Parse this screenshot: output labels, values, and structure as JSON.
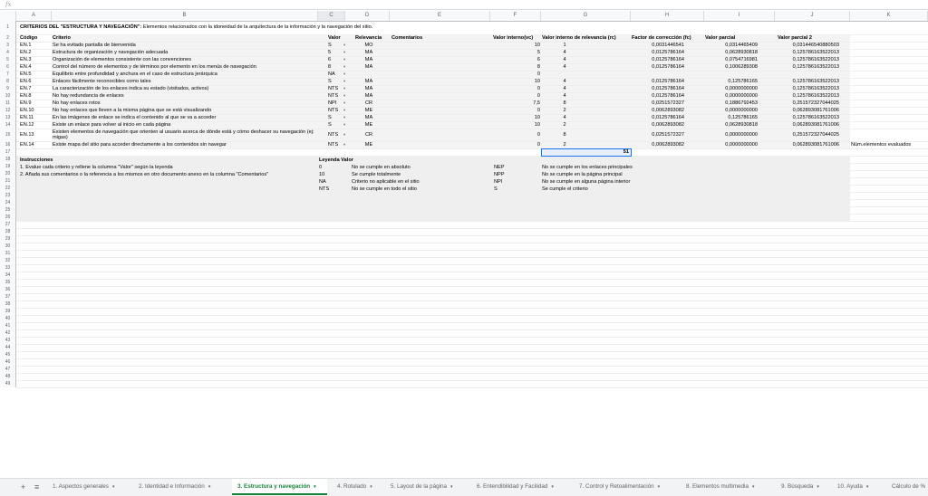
{
  "formula_bar": {
    "fx_label": "fx",
    "content": ""
  },
  "columns": [
    "A",
    "B",
    "C",
    "D",
    "E",
    "F",
    "G",
    "H",
    "I",
    "J",
    "K"
  ],
  "row_numbers": [
    "1",
    "2",
    "3",
    "4",
    "5",
    "6",
    "7",
    "8",
    "9",
    "10",
    "11",
    "12",
    "13",
    "14",
    "15",
    "16",
    "17",
    "18",
    "19",
    "20",
    "21",
    "22",
    "23",
    "24",
    "25",
    "26",
    "27",
    "28",
    "29",
    "30",
    "31",
    "32",
    "33",
    "34",
    "35",
    "36",
    "37",
    "38",
    "39",
    "40",
    "41",
    "42",
    "43",
    "44",
    "45",
    "46",
    "47",
    "48",
    "49"
  ],
  "title": {
    "bold": "CRITERIOS DEL \"ESTRUCTURA Y NAVEGACIÓN\":",
    "rest": " Elementos relacionados con la idoneidad de la arquitectura de la información y la navegación del sitio."
  },
  "headers": {
    "codigo": "Código",
    "criterio": "Criterio",
    "valor": "Valor",
    "relevancia": "Relevancia",
    "comentarios": "Comentarios",
    "valor_interno": "Valor interno(vc)",
    "valor_interno_rel": "Valor interno de relevancia (rc)",
    "factor": "Factor de corrección (fc)",
    "valor_parcial": "Valor parcial",
    "valor_parcial2": "Valor parcial 2"
  },
  "rows": [
    {
      "code": "EN.1",
      "criterio": "Se ha evitado pantalla de bienvenida",
      "valor": "S",
      "rel": "MO",
      "vi": "10",
      "vr": "1",
      "fc": "0,0031446541",
      "vp": "0,0314465409",
      "vp2": "0,03144654088050​3"
    },
    {
      "code": "EN.2",
      "criterio": "Estructura de organización y navegación adecuada",
      "valor": "5",
      "rel": "MA",
      "vi": "5",
      "vr": "4",
      "fc": "0,0125786164",
      "vp": "0,0628930818",
      "vp2": "0,125786163522013"
    },
    {
      "code": "EN.3",
      "criterio": "Organización de elementos consistente con las convenciones",
      "valor": "6",
      "rel": "MA",
      "vi": "6",
      "vr": "4",
      "fc": "0,0125786164",
      "vp": "0,0754716981",
      "vp2": "0,125786163522013"
    },
    {
      "code": "EN.4",
      "criterio": "Control del número de elementos y de términos por elemento en los menús de navegación",
      "valor": "8",
      "rel": "MA",
      "vi": "8",
      "vr": "4",
      "fc": "0,0125786164",
      "vp": "0,1006289308",
      "vp2": "0,125786163522013"
    },
    {
      "code": "EN.5",
      "criterio": "Equilibrio entre profundidad y anchura en el caso de estructura jerárquica",
      "valor": "NA",
      "rel": "",
      "vi": "0",
      "vr": "",
      "fc": "",
      "vp": "",
      "vp2": ""
    },
    {
      "code": "EN.6",
      "criterio": "Enlaces fácilmente reconocibles como tales",
      "valor": "S",
      "rel": "MA",
      "vi": "10",
      "vr": "4",
      "fc": "0,0125786164",
      "vp": "0,125786165",
      "vp2": "0,125786163522013"
    },
    {
      "code": "EN.7",
      "criterio": "La caracterización de los enlaces indica su estado (visitados, activos)",
      "valor": "NTS",
      "rel": "MA",
      "vi": "0",
      "vr": "4",
      "fc": "0,0125786164",
      "vp": "0,0000000000",
      "vp2": "0,125786163522013"
    },
    {
      "code": "EN.8",
      "criterio": "No hay redundancia de enlaces",
      "valor": "NTS",
      "rel": "MA",
      "vi": "0",
      "vr": "4",
      "fc": "0,0125786164",
      "vp": "0,0000000000",
      "vp2": "0,125786163522013"
    },
    {
      "code": "EN.9",
      "criterio": "No hay enlaces rotos",
      "valor": "NPI",
      "rel": "CR",
      "vi": "7,5",
      "vr": "8",
      "fc": "0,0251572327",
      "vp": "0,1886792453",
      "vp2": "0,251572327044025"
    },
    {
      "code": "EN.10",
      "criterio": "No hay enlaces que lleven a la misma página que se está visualizando",
      "valor": "NTS",
      "rel": "ME",
      "vi": "0",
      "vr": "2",
      "fc": "0,0062893082",
      "vp": "0,0000000000",
      "vp2": "0,0628930817610​06"
    },
    {
      "code": "EN.11",
      "criterio": "En las imágenes de enlace se indica el contenido al que se va a acceder",
      "valor": "S",
      "rel": "MA",
      "vi": "10",
      "vr": "4",
      "fc": "0,0125786164",
      "vp": "0,125786165",
      "vp2": "0,125786163522013"
    },
    {
      "code": "EN.12",
      "criterio": "Existe un enlace para volver al inicio en cada página",
      "valor": "S",
      "rel": "ME",
      "vi": "10",
      "vr": "2",
      "fc": "0,0062893082",
      "vp": "0,0628930818",
      "vp2": "0,0628930817610​06"
    },
    {
      "code": "EN.13",
      "criterio": "Existen elementos de navegación que orienten al usuario acerca de dónde está y cómo deshacer su navegación (ej: migas)",
      "valor": "NTS",
      "rel": "CR",
      "vi": "0",
      "vr": "8",
      "fc": "0,0251572327",
      "vp": "0,0000000000",
      "vp2": "0,251572327044025"
    },
    {
      "code": "EN.14",
      "criterio": "Existe mapa del sitio para acceder directamente a los contenidos sin navegar",
      "valor": "NTS",
      "rel": "ME",
      "vi": "0",
      "vr": "2",
      "fc": "0,0062893082",
      "vp": "0,0000000000",
      "vp2": "0,0628930817610​06"
    }
  ],
  "total_vr": "51",
  "count_label": "Núm.elementos evaluados",
  "instructions": {
    "title": "Instrucciones",
    "line1": "1. Evalue cada criterio y rellene la columna \"Valor\" según la leyenda",
    "line2": "2. Añada sus comentarios o la referencia a los mismos en otro documento anexo en la columna \"Comentarios\""
  },
  "legend": {
    "title": "Leyenda Valor",
    "items": [
      {
        "k": "0",
        "v": "No se cumple en absoluto",
        "k2": "NEP",
        "v2": "No se cumple en los enlaces principales"
      },
      {
        "k": "10",
        "v": "Se cumple totalmente",
        "k2": "NPP",
        "v2": "No se cumple en la página principal"
      },
      {
        "k": "NA",
        "v": "Criterio no aplicable en el sitio",
        "k2": "NPI",
        "v2": "No se cumple en alguna página interior"
      },
      {
        "k": "NTS",
        "v": "No se cumple en todo el sitio",
        "k2": "S",
        "v2": "Se cumple el criterio"
      }
    ]
  },
  "tabs": [
    {
      "label": "1. Aspectos generales"
    },
    {
      "label": "2. Identidad e Información"
    },
    {
      "label": "3. Estructura y navegación"
    },
    {
      "label": "4. Rotulado"
    },
    {
      "label": "5. Layout de la página"
    },
    {
      "label": "6. Entendibilidad y Facilidad"
    },
    {
      "label": "7. Control y Retoalimentación"
    },
    {
      "label": "8. Elementos multimedia"
    },
    {
      "label": "9. Búsqueda"
    },
    {
      "label": "10. Ayuda"
    },
    {
      "label": "Cálculo de %"
    }
  ],
  "icons": {
    "add": "+",
    "menu": "≡",
    "caret": "▾"
  },
  "colors": {
    "active_tab": "#188038",
    "legend_bg": "#efefef"
  }
}
